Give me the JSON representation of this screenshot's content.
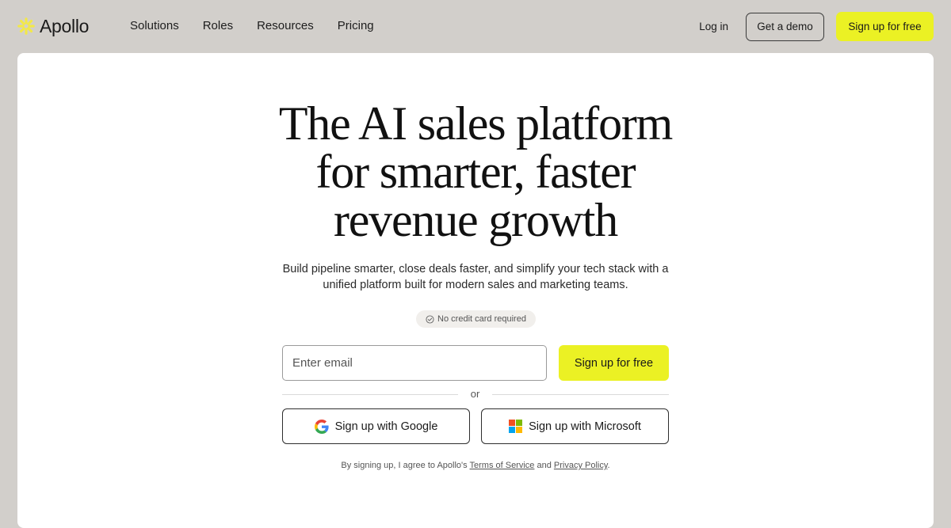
{
  "brand": {
    "name": "Apollo",
    "accent_color": "#ebf124",
    "logo_color": "#f2e84a"
  },
  "nav": {
    "links": [
      {
        "label": "Solutions"
      },
      {
        "label": "Roles"
      },
      {
        "label": "Resources"
      },
      {
        "label": "Pricing"
      }
    ],
    "login_label": "Log in",
    "demo_label": "Get a demo",
    "signup_label": "Sign up for free"
  },
  "hero": {
    "headline_lines": [
      "The AI sales platform",
      "for smarter, faster",
      "revenue growth"
    ],
    "subtitle": "Build pipeline smarter, close deals faster, and simplify your tech stack with a unified platform built for modern sales and marketing teams.",
    "badge": {
      "icon": "check-circle-icon",
      "text": "No credit card required"
    }
  },
  "signup_form": {
    "email_placeholder": "Enter email",
    "email_value": "",
    "submit_label": "Sign up for free",
    "divider_text": "or",
    "google_label": "Sign up with Google",
    "microsoft_label": "Sign up with Microsoft"
  },
  "legal": {
    "prefix": "By signing up, I agree to Apollo's ",
    "terms_label": "Terms of Service",
    "and_text": " and ",
    "privacy_label": "Privacy Policy",
    "suffix": "."
  }
}
